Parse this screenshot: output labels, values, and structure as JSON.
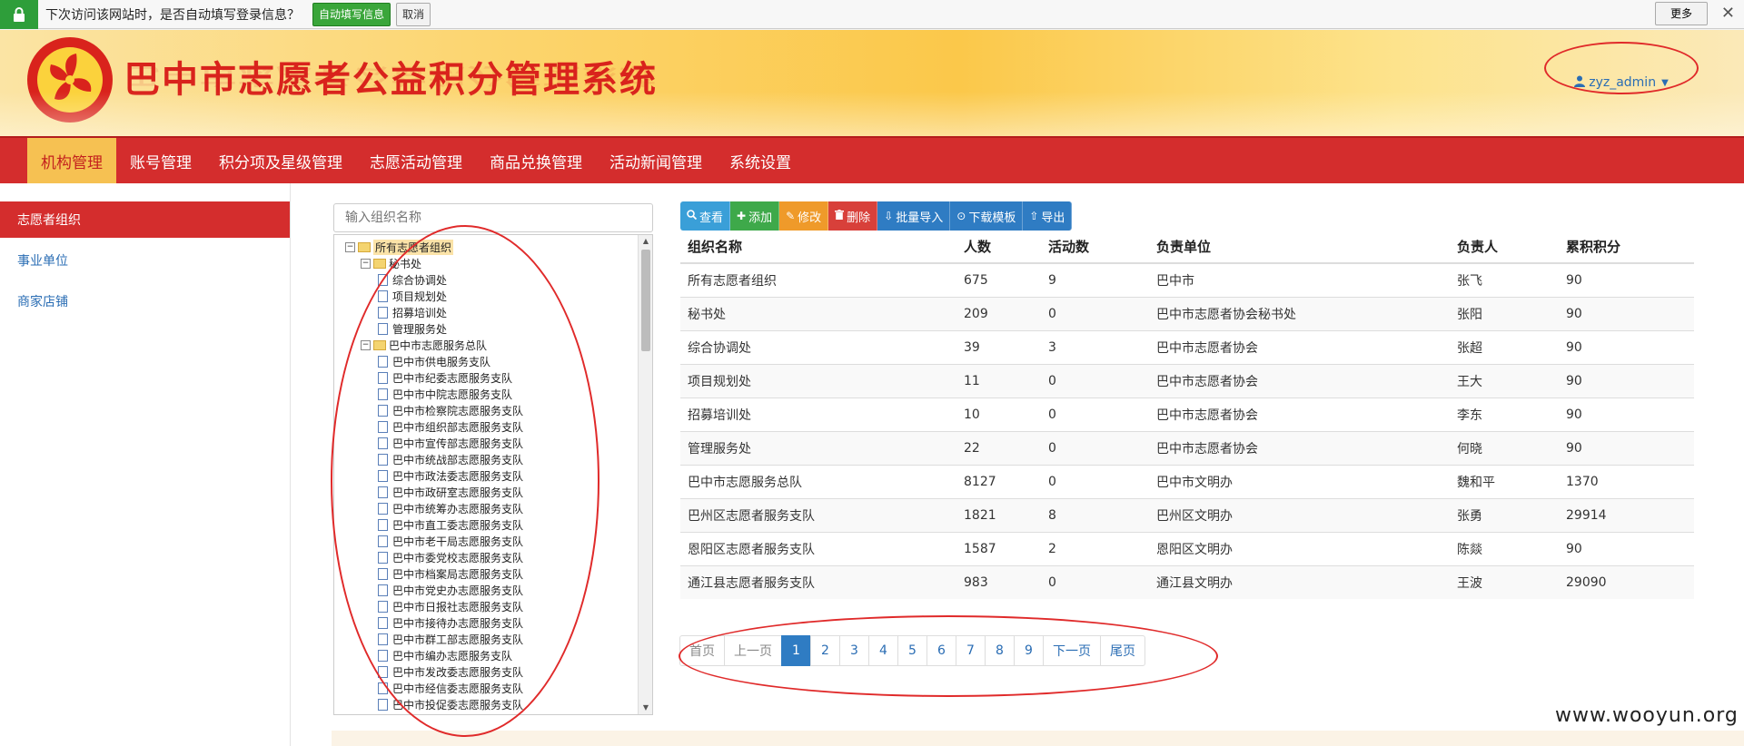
{
  "password_bar": {
    "message": "下次访问该网站时，是否自动填写登录信息？",
    "autofill_label": "自动填写信息",
    "cancel_label": "取消",
    "more_label": "更多",
    "close_label": "✕"
  },
  "header": {
    "title": "巴中市志愿者公益积分管理系统",
    "user": "zyz_admin",
    "colors": {
      "title": "#d9231c",
      "user": "#2a6db4"
    }
  },
  "nav": {
    "items": [
      {
        "label": "机构管理",
        "active": true
      },
      {
        "label": "账号管理"
      },
      {
        "label": "积分项及星级管理"
      },
      {
        "label": "志愿活动管理"
      },
      {
        "label": "商品兑换管理"
      },
      {
        "label": "活动新闻管理"
      },
      {
        "label": "系统设置"
      }
    ]
  },
  "sidebar": {
    "items": [
      {
        "label": "志愿者组织",
        "active": true
      },
      {
        "label": "事业单位"
      },
      {
        "label": "商家店铺"
      }
    ]
  },
  "search": {
    "placeholder": "输入组织名称"
  },
  "tree": {
    "nodes": [
      {
        "label": "所有志愿者组织",
        "level": 0,
        "type": "folder",
        "expanded": true,
        "selected": true
      },
      {
        "label": "秘书处",
        "level": 1,
        "type": "folder",
        "expanded": true
      },
      {
        "label": "综合协调处",
        "level": 2,
        "type": "doc"
      },
      {
        "label": "项目规划处",
        "level": 2,
        "type": "doc"
      },
      {
        "label": "招募培训处",
        "level": 2,
        "type": "doc"
      },
      {
        "label": "管理服务处",
        "level": 2,
        "type": "doc"
      },
      {
        "label": "巴中市志愿服务总队",
        "level": 1,
        "type": "folder",
        "expanded": true
      },
      {
        "label": "巴中市供电服务支队",
        "level": 2,
        "type": "doc"
      },
      {
        "label": "巴中市纪委志愿服务支队",
        "level": 2,
        "type": "doc"
      },
      {
        "label": "巴中市中院志愿服务支队",
        "level": 2,
        "type": "doc"
      },
      {
        "label": "巴中市检察院志愿服务支队",
        "level": 2,
        "type": "doc"
      },
      {
        "label": "巴中市组织部志愿服务支队",
        "level": 2,
        "type": "doc"
      },
      {
        "label": "巴中市宣传部志愿服务支队",
        "level": 2,
        "type": "doc"
      },
      {
        "label": "巴中市统战部志愿服务支队",
        "level": 2,
        "type": "doc"
      },
      {
        "label": "巴中市政法委志愿服务支队",
        "level": 2,
        "type": "doc"
      },
      {
        "label": "巴中市政研室志愿服务支队",
        "level": 2,
        "type": "doc"
      },
      {
        "label": "巴中市统筹办志愿服务支队",
        "level": 2,
        "type": "doc"
      },
      {
        "label": "巴中市直工委志愿服务支队",
        "level": 2,
        "type": "doc"
      },
      {
        "label": "巴中市老干局志愿服务支队",
        "level": 2,
        "type": "doc"
      },
      {
        "label": "巴中市委党校志愿服务支队",
        "level": 2,
        "type": "doc"
      },
      {
        "label": "巴中市档案局志愿服务支队",
        "level": 2,
        "type": "doc"
      },
      {
        "label": "巴中市党史办志愿服务支队",
        "level": 2,
        "type": "doc"
      },
      {
        "label": "巴中市日报社志愿服务支队",
        "level": 2,
        "type": "doc"
      },
      {
        "label": "巴中市接待办志愿服务支队",
        "level": 2,
        "type": "doc"
      },
      {
        "label": "巴中市群工部志愿服务支队",
        "level": 2,
        "type": "doc"
      },
      {
        "label": "巴中市编办志愿服务支队",
        "level": 2,
        "type": "doc"
      },
      {
        "label": "巴中市发改委志愿服务支队",
        "level": 2,
        "type": "doc"
      },
      {
        "label": "巴中市经信委志愿服务支队",
        "level": 2,
        "type": "doc"
      },
      {
        "label": "巴中市投促委志愿服务支队",
        "level": 2,
        "type": "doc"
      }
    ]
  },
  "toolbar": {
    "buttons": [
      {
        "label": "查看",
        "icon": "search-icon",
        "color": "#3a9fd8"
      },
      {
        "label": "添加",
        "icon": "plus-icon",
        "color": "#3ea94a"
      },
      {
        "label": "修改",
        "icon": "pencil-icon",
        "color": "#ef9a2a"
      },
      {
        "label": "删除",
        "icon": "trash-icon",
        "color": "#d8403a"
      },
      {
        "label": "批量导入",
        "icon": "import-icon",
        "color": "#2f7cc3"
      },
      {
        "label": "下载模板",
        "icon": "download-icon",
        "color": "#2f7cc3"
      },
      {
        "label": "导出",
        "icon": "export-icon",
        "color": "#2f7cc3"
      }
    ]
  },
  "table": {
    "headers": [
      "组织名称",
      "人数",
      "活动数",
      "负责单位",
      "负责人",
      "累积积分"
    ],
    "rows": [
      [
        "所有志愿者组织",
        "675",
        "9",
        "巴中市",
        "张飞",
        "90"
      ],
      [
        "秘书处",
        "209",
        "0",
        "巴中市志愿者协会秘书处",
        "张阳",
        "90"
      ],
      [
        "综合协调处",
        "39",
        "3",
        "巴中市志愿者协会",
        "张超",
        "90"
      ],
      [
        "项目规划处",
        "11",
        "0",
        "巴中市志愿者协会",
        "王大",
        "90"
      ],
      [
        "招募培训处",
        "10",
        "0",
        "巴中市志愿者协会",
        "李东",
        "90"
      ],
      [
        "管理服务处",
        "22",
        "0",
        "巴中市志愿者协会",
        "何晓",
        "90"
      ],
      [
        "巴中市志愿服务总队",
        "8127",
        "0",
        "巴中市文明办",
        "魏和平",
        "1370"
      ],
      [
        "巴州区志愿者服务支队",
        "1821",
        "8",
        "巴州区文明办",
        "张勇",
        "29914"
      ],
      [
        "恩阳区志愿者服务支队",
        "1587",
        "2",
        "恩阳区文明办",
        "陈燚",
        "90"
      ],
      [
        "通江县志愿者服务支队",
        "983",
        "0",
        "通江县文明办",
        "王波",
        "29090"
      ]
    ]
  },
  "pagination": {
    "first": "首页",
    "prev": "上一页",
    "pages": [
      "1",
      "2",
      "3",
      "4",
      "5",
      "6",
      "7",
      "8",
      "9"
    ],
    "current": "1",
    "next": "下一页",
    "last": "尾页"
  },
  "watermark": "www.wooyun.org"
}
